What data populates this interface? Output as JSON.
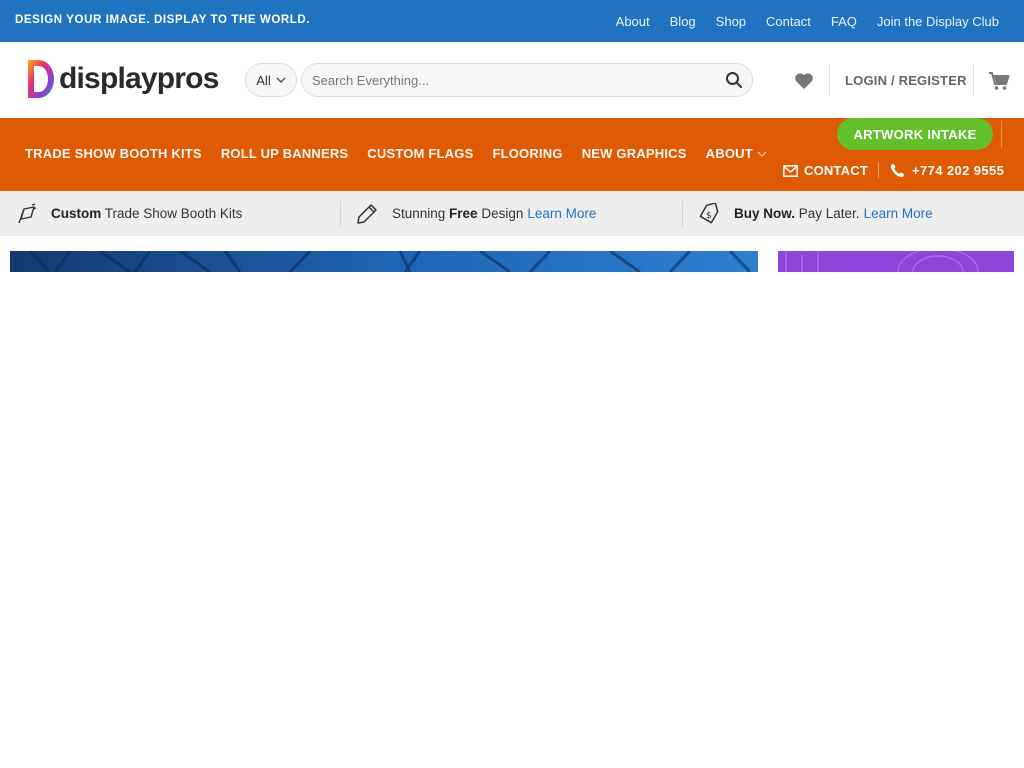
{
  "topbar": {
    "tagline": "DESIGN YOUR IMAGE. DISPLAY TO THE WORLD.",
    "links": [
      "About",
      "Blog",
      "Shop",
      "Contact",
      "FAQ",
      "Join the Display Club"
    ]
  },
  "header": {
    "logo_text": "displaypros",
    "category_select": "All",
    "search_placeholder": "Search Everything...",
    "login_label": "LOGIN / REGISTER"
  },
  "mainnav": {
    "items": [
      "TRADE SHOW BOOTH KITS",
      "ROLL UP BANNERS",
      "CUSTOM FLAGS",
      "FLOORING",
      "NEW GRAPHICS"
    ],
    "about_label": "ABOUT",
    "artwork_button": "ARTWORK INTAKE",
    "contact_label": "CONTACT",
    "phone_label": "+774 202 9555"
  },
  "features": [
    {
      "bold": "Custom",
      "text": " Trade Show Booth Kits",
      "icon": "banner-stand-icon"
    },
    {
      "pre": "Stunning ",
      "bold": "Free",
      "text": " Design",
      "link": "Learn More",
      "icon": "pencil-icon"
    },
    {
      "bold": "Buy Now.",
      "text": " Pay Later.",
      "link": "Learn More",
      "icon": "price-tag-icon"
    }
  ],
  "colors": {
    "topbar": "#1f73c0",
    "nav": "#de5b04",
    "cta": "#64bf2c",
    "link": "#1f73c0",
    "feature_bar": "#eeeeee"
  }
}
